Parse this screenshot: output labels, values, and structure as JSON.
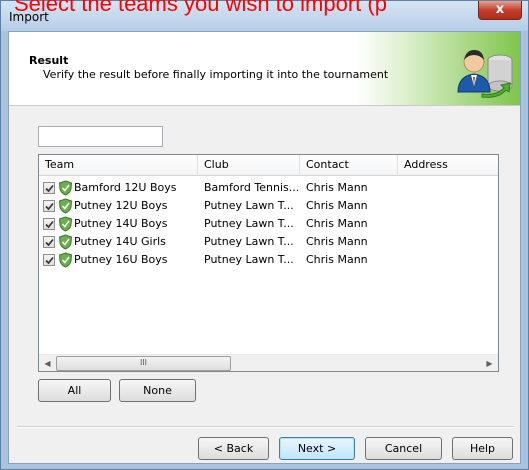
{
  "annotation": "Select the teams you wish to import (p",
  "window": {
    "title": "Import",
    "close_glyph": "x"
  },
  "header": {
    "title": "Result",
    "subtitle": "Verify the result before finally importing it into the tournament",
    "icon": "person-database-icon"
  },
  "filter": {
    "value": "",
    "placeholder": ""
  },
  "table": {
    "columns": [
      "Team",
      "Club",
      "Contact",
      "Address"
    ],
    "rows": [
      {
        "checked": true,
        "team": "Bamford 12U Boys",
        "club": "Bamford Tennis...",
        "contact": "Chris Mann",
        "address": ""
      },
      {
        "checked": true,
        "team": "Putney 12U Boys",
        "club": "Putney Lawn T...",
        "contact": "Chris Mann",
        "address": ""
      },
      {
        "checked": true,
        "team": "Putney 14U Boys",
        "club": "Putney Lawn T...",
        "contact": "Chris Mann",
        "address": ""
      },
      {
        "checked": true,
        "team": "Putney 14U Girls",
        "club": "Putney Lawn T...",
        "contact": "Chris Mann",
        "address": ""
      },
      {
        "checked": true,
        "team": "Putney 16U Boys",
        "club": "Putney Lawn T...",
        "contact": "Chris Mann",
        "address": ""
      }
    ],
    "scroll_thumb_glyph": "III",
    "scroll_left_glyph": "◀",
    "scroll_right_glyph": "▶"
  },
  "selection_buttons": {
    "all": "All",
    "none": "None"
  },
  "footer": {
    "back": "< Back",
    "next": "Next >",
    "cancel": "Cancel",
    "help": "Help"
  },
  "colors": {
    "annotation": "#ff0000",
    "shield_green": "#6ab04c",
    "accent_green": "#7fc54b"
  }
}
